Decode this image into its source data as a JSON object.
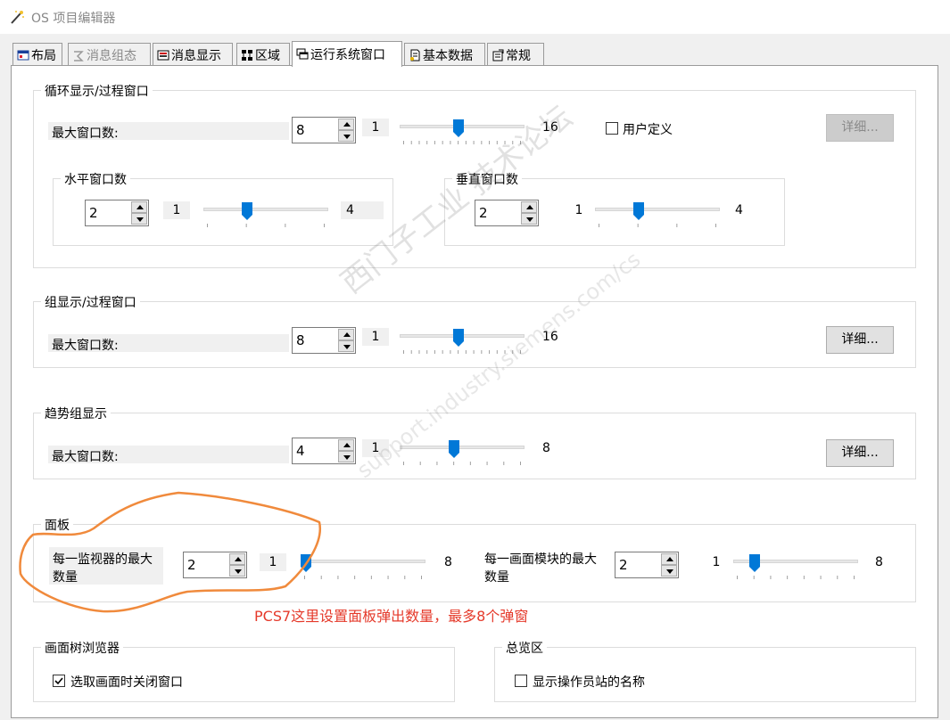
{
  "window": {
    "title": "OS 项目编辑器"
  },
  "tabs": [
    {
      "label": "布局",
      "active": false,
      "disabled": false
    },
    {
      "label": "消息组态",
      "active": false,
      "disabled": true
    },
    {
      "label": "消息显示",
      "active": false,
      "disabled": false
    },
    {
      "label": "区域",
      "active": false,
      "disabled": false
    },
    {
      "label": "运行系统窗口",
      "active": true,
      "disabled": false
    },
    {
      "label": "基本数据",
      "active": false,
      "disabled": false
    },
    {
      "label": "常规",
      "active": false,
      "disabled": false
    }
  ],
  "loop_group": {
    "title": "循环显示/过程窗口",
    "max_label": "最大窗口数:",
    "max_value": "8",
    "slider": {
      "min": "1",
      "max": "16",
      "value": 8
    },
    "user_defined_label": "用户定义",
    "user_defined_checked": false,
    "details_label": "详细...",
    "horizontal": {
      "title": "水平窗口数",
      "value": "2",
      "slider": {
        "min": "1",
        "max": "4",
        "value": 2
      }
    },
    "vertical": {
      "title": "垂直窗口数",
      "value": "2",
      "slider": {
        "min": "1",
        "max": "4",
        "value": 2
      }
    }
  },
  "group_display": {
    "title": "组显示/过程窗口",
    "max_label": "最大窗口数:",
    "max_value": "8",
    "slider": {
      "min": "1",
      "max": "16",
      "value": 8
    },
    "details_label": "详细..."
  },
  "trend_group": {
    "title": "趋势组显示",
    "max_label": "最大窗口数:",
    "max_value": "4",
    "slider": {
      "min": "1",
      "max": "8",
      "value": 4
    },
    "details_label": "详细..."
  },
  "faceplate": {
    "title": "面板",
    "per_monitor_label_line1": "每一监视器的最大",
    "per_monitor_label_line2": "数量",
    "per_monitor_value": "2",
    "per_monitor_slider": {
      "min": "1",
      "max": "8",
      "value": 1
    },
    "per_block_label_line1": "每一画面模块的最大",
    "per_block_label_line2": "数量",
    "per_block_value": "2",
    "per_block_slider": {
      "min": "1",
      "max": "8",
      "value": 2
    }
  },
  "annotation": {
    "text": "PCS7这里设置面板弹出数量，最多8个弹窗",
    "color": "#e53a2b",
    "circle_color": "#f08a3c"
  },
  "tree_browser": {
    "title": "画面树浏览器",
    "close_label": "选取画面时关闭窗口",
    "checked": true
  },
  "overview": {
    "title": "总览区",
    "show_name_label": "显示操作员站的名称",
    "checked": false
  },
  "watermark": {
    "line1": "西门子工业  技术论坛",
    "line2": "support.industry.siemens.com/cs"
  },
  "colors": {
    "accent": "#0078d7",
    "panel_bg": "#ffffff",
    "window_bg": "#f0f0f0"
  }
}
